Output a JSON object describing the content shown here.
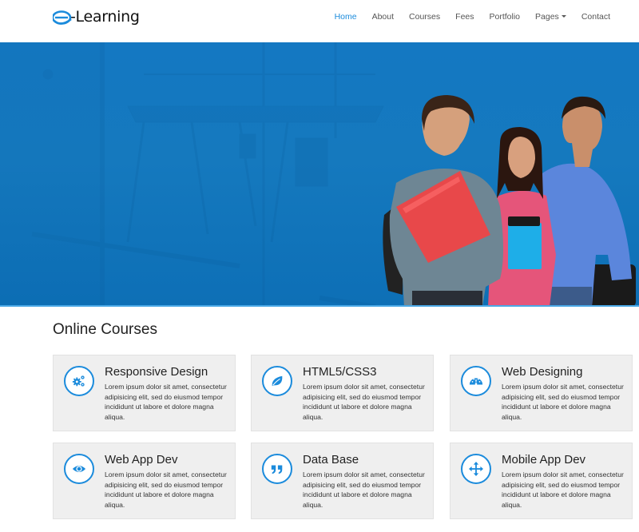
{
  "header": {
    "logo": {
      "prefix": "e",
      "text": "-Learning"
    },
    "nav": [
      {
        "label": "Home",
        "active": true
      },
      {
        "label": "About",
        "active": false
      },
      {
        "label": "Courses",
        "active": false
      },
      {
        "label": "Fees",
        "active": false
      },
      {
        "label": "Portfolio",
        "active": false
      },
      {
        "label": "Pages",
        "active": false,
        "dropdown": true
      },
      {
        "label": "Contact",
        "active": false
      }
    ]
  },
  "hero": {
    "image_alt": "Three smiling students holding books and folders",
    "background_color": "#1478c2"
  },
  "section": {
    "title": "Online Courses"
  },
  "courses": [
    {
      "title": "Responsive Design",
      "icon": "gears-icon",
      "text": "Lorem ipsum dolor sit amet, consectetur adipisicing elit, sed do eiusmod tempor incididunt ut labore et dolore magna aliqua."
    },
    {
      "title": "HTML5/CSS3",
      "icon": "leaf-icon",
      "text": "Lorem ipsum dolor sit amet, consectetur adipisicing elit, sed do eiusmod tempor incididunt ut labore et dolore magna aliqua."
    },
    {
      "title": "Web Designing",
      "icon": "dashboard-icon",
      "text": "Lorem ipsum dolor sit amet, consectetur adipisicing elit, sed do eiusmod tempor incididunt ut labore et dolore magna aliqua."
    },
    {
      "title": "Web App Dev",
      "icon": "eye-icon",
      "text": "Lorem ipsum dolor sit amet, consectetur adipisicing elit, sed do eiusmod tempor incididunt ut labore et dolore magna aliqua."
    },
    {
      "title": "Data Base",
      "icon": "quote-icon",
      "text": "Lorem ipsum dolor sit amet, consectetur adipisicing elit, sed do eiusmod tempor incididunt ut labore et dolore magna aliqua."
    },
    {
      "title": "Mobile App Dev",
      "icon": "move-arrows-icon",
      "text": "Lorem ipsum dolor sit amet, consectetur adipisicing elit, sed do eiusmod tempor incididunt ut labore et dolore magna aliqua."
    }
  ],
  "colors": {
    "accent": "#1b8bdc",
    "hero_blue": "#1478c2",
    "card_bg": "#efefef",
    "text_dark": "#222222",
    "nav_text": "#555555"
  }
}
